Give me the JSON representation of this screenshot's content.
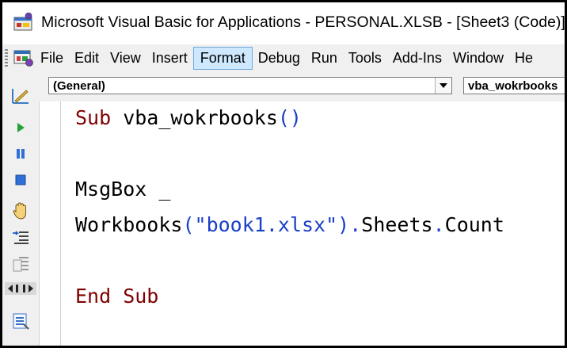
{
  "window": {
    "title": "Microsoft Visual Basic for Applications - PERSONAL.XLSB - [Sheet3 (Code)]"
  },
  "menu": {
    "items": [
      {
        "label": "File",
        "active": false
      },
      {
        "label": "Edit",
        "active": false
      },
      {
        "label": "View",
        "active": false
      },
      {
        "label": "Insert",
        "active": false
      },
      {
        "label": "Format",
        "active": true
      },
      {
        "label": "Debug",
        "active": false
      },
      {
        "label": "Run",
        "active": false
      },
      {
        "label": "Tools",
        "active": false
      },
      {
        "label": "Add-Ins",
        "active": false
      },
      {
        "label": "Window",
        "active": false
      },
      {
        "label": "He",
        "active": false
      }
    ]
  },
  "combos": {
    "object": "(General)",
    "procedure": "vba_wokrbooks"
  },
  "toolbar": {
    "buttons": [
      "design-mode-icon",
      "run-icon",
      "break-icon",
      "reset-icon",
      "hand-icon",
      "indent-icon",
      "outdent-icon",
      "splitter-icon",
      "object-browser-icon"
    ]
  },
  "code": {
    "line1_kw": "Sub",
    "line1_name": " vba_wokrbooks",
    "line1_parens": "()",
    "line2": "MsgBox _",
    "line3_a": "Workbooks",
    "line3_b": "(",
    "line3_str": "\"book1.xlsx\"",
    "line3_c": ").",
    "line3_d": "Sheets",
    "line3_e": ".",
    "line3_f": "Count",
    "line4_kw": "End Sub"
  },
  "colors": {
    "keyword": "#7f0000",
    "punctuation": "#1a3fc8",
    "menu_highlight": "#cde8ff"
  }
}
